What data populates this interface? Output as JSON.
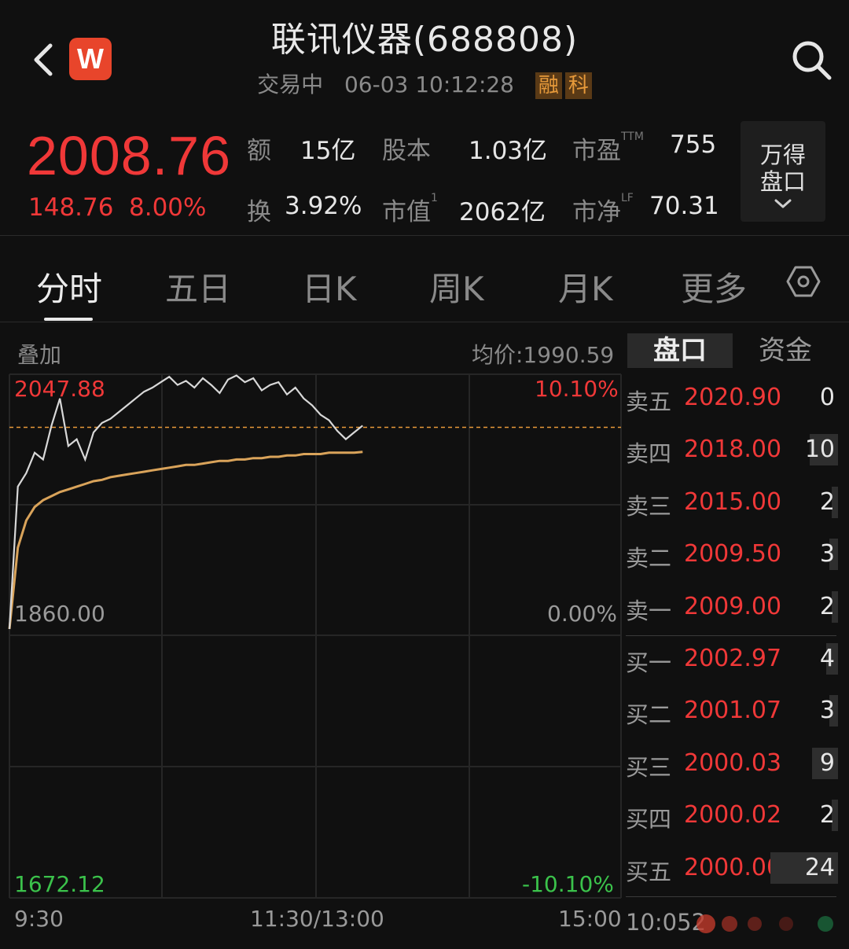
{
  "header": {
    "title": "联讯仪器(688808)",
    "status": "交易中",
    "datetime": "06-03 10:12:28",
    "tags": [
      "融",
      "科"
    ],
    "badge_letter": "W"
  },
  "quote": {
    "price": "2008.76",
    "change_abs": "148.76",
    "change_pct": "8.00%",
    "stats": {
      "amount_label": "额",
      "amount": "15亿",
      "shares_label": "股本",
      "shares": "1.03亿",
      "pe_label": "市盈",
      "pe_sup": "TTM",
      "pe": "755",
      "turnover_label": "换",
      "turnover": "3.92%",
      "mktcap_label": "市值",
      "mktcap_sup": "1",
      "mktcap": "2062亿",
      "pb_label": "市净",
      "pb_sup": "LF",
      "pb": "70.31"
    },
    "depth_button": [
      "万得",
      "盘口"
    ]
  },
  "tabs": [
    "分时",
    "五日",
    "日K",
    "周K",
    "月K",
    "更多"
  ],
  "chart": {
    "overlay_label": "叠加",
    "avg_label": "均价:1990.59",
    "y_top": "2047.88",
    "y_mid": "1860.00",
    "y_bottom": "1672.12",
    "pct_top": "10.10%",
    "pct_mid": "0.00%",
    "pct_bottom": "-10.10%",
    "x_labels": [
      "9:30",
      "11:30/13:00",
      "15:00"
    ]
  },
  "chart_data": {
    "type": "line",
    "ylim": [
      1672.12,
      2047.88
    ],
    "reference_line": 2008.76,
    "x": [
      0,
      1,
      2,
      3,
      4,
      5,
      6,
      7,
      8,
      9,
      10,
      11,
      12,
      13,
      14,
      15,
      16,
      17,
      18,
      19,
      20,
      21,
      22,
      23,
      24,
      25,
      26,
      27,
      28,
      29,
      30,
      31,
      32,
      33,
      34,
      35,
      36,
      37,
      38,
      39,
      40,
      41,
      42
    ],
    "series": [
      {
        "values": [
          1860,
          1965,
          1975,
          1990,
          1985,
          2010,
          2030,
          1995,
          2000,
          1985,
          2005,
          2012,
          2015,
          2020,
          2025,
          2030,
          2035,
          2038,
          2042,
          2046,
          2040,
          2043,
          2038,
          2045,
          2040,
          2034,
          2044,
          2047,
          2042,
          2045,
          2036,
          2040,
          2042,
          2033,
          2038,
          2030,
          2025,
          2018,
          2014,
          2006,
          2000,
          2005,
          2010
        ],
        "color": "#d8d8d8"
      },
      {
        "values": [
          1860,
          1920,
          1940,
          1950,
          1955,
          1958,
          1961,
          1963,
          1965,
          1967,
          1969,
          1970,
          1972,
          1973,
          1974,
          1975,
          1976,
          1977,
          1978,
          1979,
          1980,
          1981,
          1981,
          1982,
          1983,
          1984,
          1984,
          1985,
          1985,
          1986,
          1986,
          1987,
          1987,
          1988,
          1988,
          1989,
          1989,
          1989,
          1990,
          1990,
          1990,
          1990,
          1990.59
        ],
        "color": "#d9a35a"
      }
    ]
  },
  "orderbook": {
    "tabs": [
      "盘口",
      "资金"
    ],
    "asks": [
      {
        "label": "卖五",
        "price": "2020.90",
        "vol": "0",
        "level": 0
      },
      {
        "label": "卖四",
        "price": "2018.00",
        "vol": "10",
        "level": 0.42
      },
      {
        "label": "卖三",
        "price": "2015.00",
        "vol": "2",
        "level": 0.09
      },
      {
        "label": "卖二",
        "price": "2009.50",
        "vol": "3",
        "level": 0.13
      },
      {
        "label": "卖一",
        "price": "2009.00",
        "vol": "2",
        "level": 0.09
      }
    ],
    "bids": [
      {
        "label": "买一",
        "price": "2002.97",
        "vol": "4",
        "level": 0.17
      },
      {
        "label": "买二",
        "price": "2001.07",
        "vol": "3",
        "level": 0.13
      },
      {
        "label": "买三",
        "price": "2000.03",
        "vol": "9",
        "level": 0.38
      },
      {
        "label": "买四",
        "price": "2000.02",
        "vol": "2",
        "level": 0.09
      },
      {
        "label": "买五",
        "price": "2000.00",
        "vol": "24",
        "level": 1.0
      }
    ],
    "trade_time": "10:052"
  },
  "colors": {
    "up": "#f03838",
    "down": "#3bc24b",
    "avg_line": "#d9a35a",
    "price_line": "#d8d8d8",
    "ref_line": "#e79a3a",
    "grid": "#262626"
  }
}
